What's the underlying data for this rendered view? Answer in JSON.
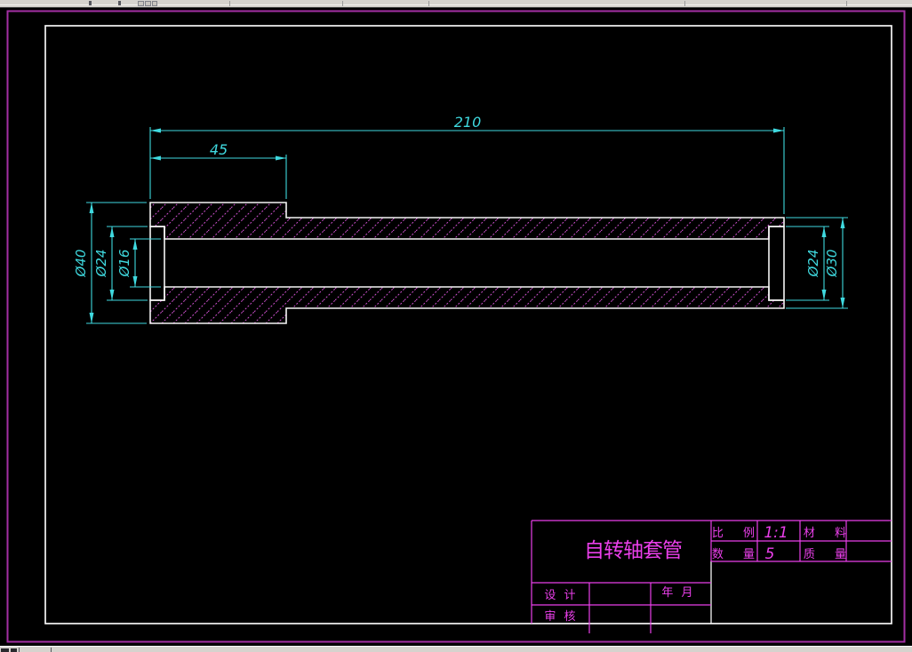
{
  "drawing": {
    "dimensions": {
      "total_length": "210",
      "flange_length": "45",
      "flange_outer_dia": "Ø40",
      "left_counterbore_dia": "Ø24",
      "bore_dia": "Ø16",
      "right_counterbore_dia": "Ø24",
      "tube_outer_dia": "Ø30"
    },
    "colors": {
      "background": "#000000",
      "part_outline": "#f5f5f5",
      "dimension": "#3fd9df",
      "hatch": "#cc4fcc",
      "outer_border": "#a32fa3",
      "title_block": "#ea3fea"
    }
  },
  "title_block": {
    "part_name": "自转轴套管",
    "scale_label": "比 例",
    "scale_value": "1:1",
    "material_label": "材 料",
    "material_value": "",
    "quantity_label": "数 量",
    "quantity_value": "5",
    "mass_label": "质 量",
    "mass_value": "",
    "designer_label": "设 计",
    "checker_label": "审 核",
    "date_label": "年 月"
  }
}
